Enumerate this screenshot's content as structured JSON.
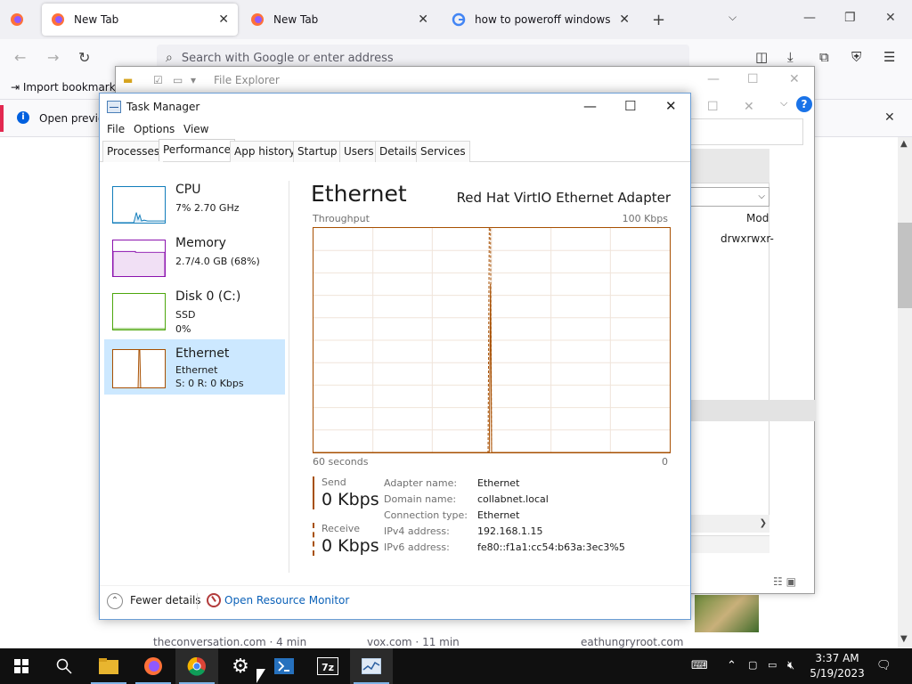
{
  "browser": {
    "tabs": [
      {
        "title": "New Tab",
        "active": true
      },
      {
        "title": "New Tab",
        "active": false
      },
      {
        "title": "how to poweroff windows from",
        "active": false
      }
    ],
    "url_placeholder": "Search with Google or enter address",
    "bookmark_import": "Import bookmarks",
    "notification": "Open previo",
    "cards": [
      {
        "source": "theconversation.com · 4 min"
      },
      {
        "source": "vox.com · 11 min"
      },
      {
        "source": "eathungryroot.com"
      }
    ]
  },
  "explorer": {
    "title": "File Explorer",
    "col_head": "Mod",
    "perm": "drwxrwxr-"
  },
  "taskmgr": {
    "title": "Task Manager",
    "menu": [
      "File",
      "Options",
      "View"
    ],
    "tabs": [
      "Processes",
      "Performance",
      "App history",
      "Startup",
      "Users",
      "Details",
      "Services"
    ],
    "resources": [
      {
        "name": "CPU",
        "line1": "7% 2.70 GHz",
        "line2": ""
      },
      {
        "name": "Memory",
        "line1": "2.7/4.0 GB (68%)",
        "line2": ""
      },
      {
        "name": "Disk 0 (C:)",
        "line1": "SSD",
        "line2": "0%"
      },
      {
        "name": "Ethernet",
        "line1": "Ethernet",
        "line2": "S: 0 R: 0 Kbps"
      }
    ],
    "selected": "Ethernet",
    "heading": "Ethernet",
    "adapter": "Red Hat VirtIO Ethernet Adapter",
    "graph": {
      "label_left_top": "Throughput",
      "label_right_top": "100 Kbps",
      "label_left_bottom": "60 seconds",
      "label_right_bottom": "0",
      "ymax_kbps": 100,
      "window_seconds": 60,
      "send_kbps": [
        [
          0,
          0
        ],
        [
          29.6,
          0
        ],
        [
          29.8,
          75
        ],
        [
          30.0,
          0
        ],
        [
          60,
          0
        ]
      ],
      "receive_kbps": [
        [
          0,
          0
        ],
        [
          29.4,
          0
        ],
        [
          29.6,
          100
        ],
        [
          29.8,
          100
        ],
        [
          30.0,
          0
        ],
        [
          60,
          0
        ]
      ]
    },
    "send_label": "Send",
    "send_value": "0 Kbps",
    "receive_label": "Receive",
    "receive_value": "0 Kbps",
    "properties": [
      {
        "k": "Adapter name:",
        "v": "Ethernet"
      },
      {
        "k": "Domain name:",
        "v": "collabnet.local"
      },
      {
        "k": "Connection type:",
        "v": "Ethernet"
      },
      {
        "k": "IPv4 address:",
        "v": "192.168.1.15"
      },
      {
        "k": "IPv6 address:",
        "v": "fe80::f1a1:cc54:b63a:3ec3%5"
      }
    ],
    "fewer_details": "Fewer details",
    "resource_monitor": "Open Resource Monitor",
    "accent": "#a74f01"
  },
  "taskbar": {
    "time": "3:37 AM",
    "date": "5/19/2023"
  }
}
